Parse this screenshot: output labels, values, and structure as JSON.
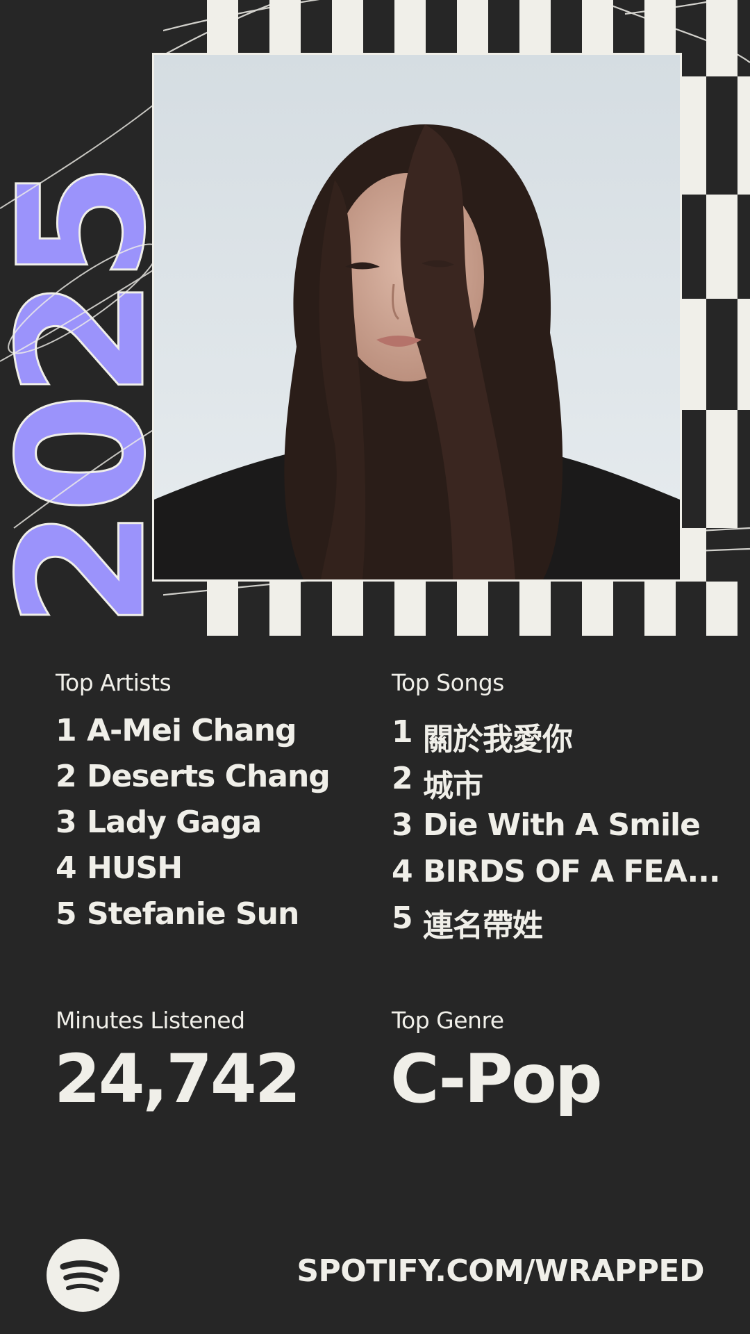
{
  "colors": {
    "background": "#262626",
    "text": "#f0efe9",
    "accent": "#9b93fb"
  },
  "year_graphic": "2025",
  "top_artists": {
    "heading": "Top Artists",
    "items": [
      {
        "rank": "1",
        "name": "A-Mei Chang"
      },
      {
        "rank": "2",
        "name": "Deserts Chang"
      },
      {
        "rank": "3",
        "name": "Lady Gaga"
      },
      {
        "rank": "4",
        "name": "HUSH"
      },
      {
        "rank": "5",
        "name": "Stefanie Sun"
      }
    ]
  },
  "top_songs": {
    "heading": "Top Songs",
    "items": [
      {
        "rank": "1",
        "name": "關於我愛你"
      },
      {
        "rank": "2",
        "name": "城市"
      },
      {
        "rank": "3",
        "name": "Die With A Smile"
      },
      {
        "rank": "4",
        "name": "BIRDS OF A FEA..."
      },
      {
        "rank": "5",
        "name": "連名帶姓"
      }
    ]
  },
  "minutes": {
    "label": "Minutes Listened",
    "value": "24,742"
  },
  "genre": {
    "label": "Top Genre",
    "value": "C-Pop"
  },
  "footer": {
    "logo_icon": "spotify-logo-icon",
    "url": "SPOTIFY.COM/WRAPPED"
  }
}
